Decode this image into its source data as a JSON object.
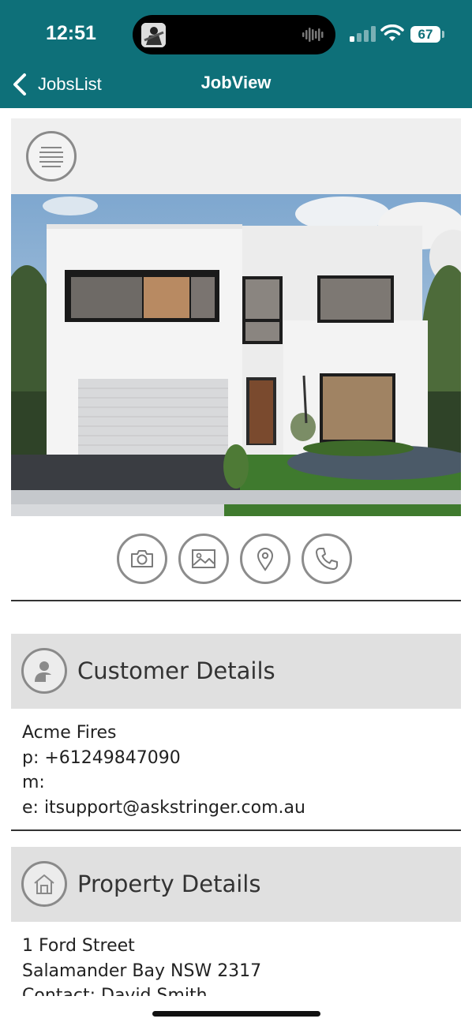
{
  "status_bar": {
    "time": "12:51",
    "battery": "67",
    "icons": [
      "signal-icon",
      "wifi-icon",
      "battery-icon",
      "audio-wave-icon"
    ]
  },
  "nav": {
    "back_label": "JobsList",
    "title": "JobView"
  },
  "actions": [
    "camera-icon",
    "image-icon",
    "location-pin-icon",
    "phone-icon"
  ],
  "customer": {
    "title": "Customer Details",
    "name": "Acme Fires",
    "phone": "p: +61249847090",
    "mobile": "m:",
    "email": "e: itsupport@askstringer.com.au"
  },
  "property": {
    "title": "Property Details",
    "street": "1 Ford Street",
    "suburb": "Salamander Bay NSW 2317",
    "partial_line": "Contact: David Smith"
  },
  "colors": {
    "header": "#0e7079",
    "section_bg": "#e0e0e0",
    "menu_bg": "#efefef"
  }
}
